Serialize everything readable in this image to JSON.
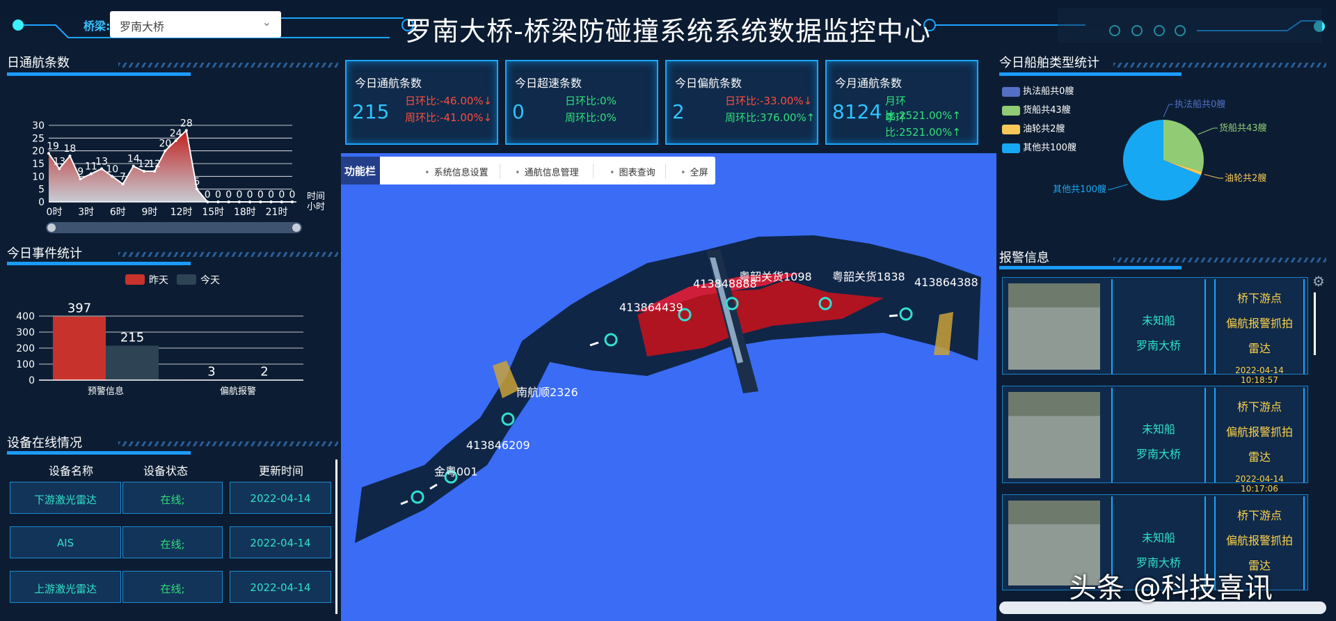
{
  "header": {
    "title": "罗南大桥-桥梁防碰撞系统系统数据监控中心",
    "bridge_label": "桥梁:",
    "bridge_value": "罗南大桥"
  },
  "daily": {
    "title": "日通航条数",
    "y_ticks": [
      "30",
      "25",
      "20",
      "15",
      "10",
      "5",
      "0"
    ],
    "x_ticks": [
      "0时",
      "3时",
      "6时",
      "9时",
      "12时",
      "15时",
      "18时",
      "21时"
    ],
    "x_unit_top": "时间",
    "x_unit_bottom": "小时"
  },
  "events": {
    "title": "今日事件统计",
    "legend": [
      "昨天",
      "今天"
    ],
    "y_ticks": [
      "400",
      "300",
      "200",
      "100",
      "0"
    ],
    "categories": [
      "预警信息",
      "偏航报警"
    ],
    "labels": [
      "397",
      "215",
      "3",
      "2"
    ]
  },
  "devices": {
    "title": "设备在线情况",
    "headers": [
      "设备名称",
      "设备状态",
      "更新时间"
    ],
    "rows": [
      [
        "下游激光雷达",
        "在线;",
        "2022-04-14"
      ],
      [
        "AIS",
        "在线;",
        "2022-04-14"
      ],
      [
        "上游激光雷达",
        "在线;",
        "2022-04-14"
      ]
    ]
  },
  "kpis": [
    {
      "label": "今日通航条数",
      "value": "215",
      "r1": "日环比:-46.00%↓",
      "r2": "周环比:-41.00%↓",
      "c1": "red",
      "c2": "red"
    },
    {
      "label": "今日超速条数",
      "value": "0",
      "r1": "日环比:0%",
      "r2": "周环比:0%",
      "c1": "green",
      "c2": "green"
    },
    {
      "label": "今日偏航条数",
      "value": "2",
      "r1": "日环比:-33.00%↓",
      "r2": "周环比:376.00%↑",
      "c1": "red",
      "c2": "green"
    },
    {
      "label": "今月通航条数",
      "value": "8124",
      "r1": "月环比:2521.00%↑",
      "r2": "季环比:2521.00%↑",
      "c1": "green",
      "c2": "green"
    }
  ],
  "funcbar": {
    "label": "功能栏",
    "items": [
      "系统信息设置",
      "通航信息管理",
      "图表查询",
      "全屏"
    ]
  },
  "map_labels": [
    "粤韶关货1098",
    "粤韶关货1838",
    "413848888",
    "413864388",
    "413864439",
    "南航顺2326",
    "413846209",
    "金粤001"
  ],
  "ship_types": {
    "title": "今日船舶类型统计",
    "legend": [
      "执法船共0艘",
      "货船共43艘",
      "油轮共2艘",
      "其他共100艘"
    ],
    "labels": [
      "执法船共0艘",
      "货船共43艘",
      "油轮共2艘",
      "其他共100艘"
    ]
  },
  "alarms": {
    "title": "报警信息",
    "items": [
      {
        "ship": "未知船",
        "bridge": "罗南大桥",
        "pos": "桥下游点",
        "type": "偏航报警抓拍",
        "src": "雷达",
        "time": "2022-04-14 10:18:57"
      },
      {
        "ship": "未知船",
        "bridge": "罗南大桥",
        "pos": "桥下游点",
        "type": "偏航报警抓拍",
        "src": "雷达",
        "time": "2022-04-14 10:17:06"
      },
      {
        "ship": "未知船",
        "bridge": "罗南大桥",
        "pos": "桥下游点",
        "type": "偏航报警抓拍",
        "src": "雷达",
        "time": ""
      }
    ]
  },
  "watermark": "头条 @科技喜讯",
  "chart_data": [
    {
      "type": "area",
      "title": "日通航条数",
      "categories": [
        "0",
        "1",
        "2",
        "3",
        "4",
        "5",
        "6",
        "7",
        "8",
        "9",
        "10",
        "11",
        "12",
        "13",
        "14",
        "15",
        "16",
        "17",
        "18",
        "19",
        "20",
        "21",
        "22",
        "23"
      ],
      "values": [
        19,
        13,
        18,
        9,
        11,
        13,
        10,
        7,
        14,
        12,
        12,
        20,
        24,
        28,
        5,
        0,
        0,
        0,
        0,
        0,
        0,
        0,
        0,
        0
      ],
      "ylim": [
        0,
        30
      ],
      "xlabel": "时间 小时",
      "ylabel": ""
    },
    {
      "type": "bar",
      "title": "今日事件统计",
      "categories": [
        "预警信息",
        "偏航报警"
      ],
      "series": [
        {
          "name": "昨天",
          "values": [
            397,
            3
          ]
        },
        {
          "name": "今天",
          "values": [
            215,
            2
          ]
        }
      ],
      "ylim": [
        0,
        400
      ]
    },
    {
      "type": "pie",
      "title": "今日船舶类型统计",
      "categories": [
        "执法船共0艘",
        "货船共43艘",
        "油轮共2艘",
        "其他共100艘"
      ],
      "values": [
        0,
        43,
        2,
        100
      ]
    }
  ],
  "colors": {
    "accent": "#1ba6ff",
    "red": "#ff4d3d",
    "green": "#2fe07a",
    "yellow": "#ffd34a",
    "map": "#3a6cf6",
    "yesterday": "#c8322c",
    "today": "#2e4455",
    "pie": [
      "#5470c6",
      "#91cc75",
      "#fac858",
      "#17a8f4"
    ]
  }
}
